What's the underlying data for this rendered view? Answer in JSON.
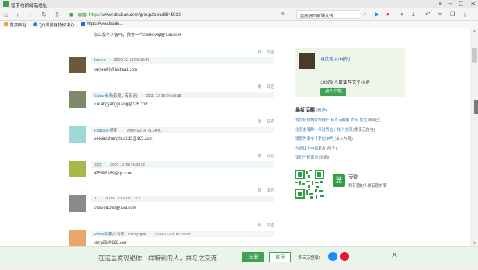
{
  "browser": {
    "tab_title": "留下你的邮箱地址",
    "address": {
      "secure_label": "豆瓣",
      "scheme": "https://",
      "host": "www.douban.com",
      "path": "/group/topic/8845032"
    },
    "search_text": "租房友回家赚大钱",
    "window_buttons": {
      "menu": "≡",
      "minimize": "–",
      "maximize": "☐",
      "close": "✕"
    }
  },
  "bookmarks": [
    {
      "label": "常用网址",
      "color": "#e8a33c"
    },
    {
      "label": "QQ浏览器特权中心",
      "color": "#1e88e5"
    },
    {
      "label": "https://www.baidu...",
      "color": "#2f64d2"
    }
  ],
  "page": {
    "top_line": "怎么没有人留吗，我留一个alerkewgl@126.com",
    "actions": {
      "like": "赞",
      "reply": "回应"
    },
    "comments": [
      {
        "user": "karyen",
        "tag": "",
        "time": "2009-12-13 09:39:46",
        "body": "karyen09@hotmail.com",
        "avatar_color": "#6b5a3a"
      },
      {
        "user": "Guitar未来",
        "tag": "(有爱，有阳光)",
        "time": "2009-12-16 00:50:15",
        "body": "liuxiangyangguang@126.com",
        "avatar_color": "#7a8a6a"
      },
      {
        "user": "Paradox",
        "tag": "(盛夏)",
        "time": "2009-12-16 21:34:01",
        "body": "weixiaoshenghuo213@163.com",
        "avatar_color": "#9fd8d8"
      },
      {
        "user": "央央",
        "tag": "",
        "time": "2009-12-18 15:23:20",
        "body": "475998269@qq.com",
        "avatar_color": "#a8b84a"
      },
      {
        "user": "X",
        "tag": "",
        "time": "2009-12-18 16:11:12",
        "body": "shaolei1030@163.com",
        "avatar_color": "#8a8a8a"
      },
      {
        "user": "Rinna阿娜",
        "tag": "(公众号：meng2girl)",
        "time": "2009-12-18 18:39:28",
        "body": "kerry89@126.com",
        "avatar_color": "#e9a56b"
      }
    ]
  },
  "sidebar": {
    "group_name": "寻找笔友(电邮)",
    "member_count": "19079 人聚集在这个小组",
    "join_label": "加入小组",
    "latest_title": "最新话题",
    "latest_more": "(更多)",
    "latest_topics": [
      {
        "title": "调为拐换搁梦梅情怀 有喜有故事 你来 我在",
        "count": "(5回应)"
      },
      {
        "title": "北京主着群，年过而立，找人交流",
        "count": "(受阅无在在)"
      },
      {
        "title": "我愿为蚕今十字信84号",
        "count": "(友人与海)"
      },
      {
        "title": "也想找个电邮笔友",
        "count": "(叮当)"
      },
      {
        "title": "我们一起读书",
        "count": "(韵韵)"
      }
    ],
    "app_name": "豆瓣",
    "app_slogan": "和有趣的人做有趣的事",
    "app_logo": "豆"
  },
  "bottom_bar": {
    "slogan": "在这里发现跟你一样特别的人，并与之交流...",
    "register_label": "注册",
    "login_label": "登录",
    "third_party_label": "第三方登录：",
    "close_icon": "✕"
  },
  "colors": {
    "accent_green": "#3fa156",
    "link_blue": "#337ab7"
  }
}
